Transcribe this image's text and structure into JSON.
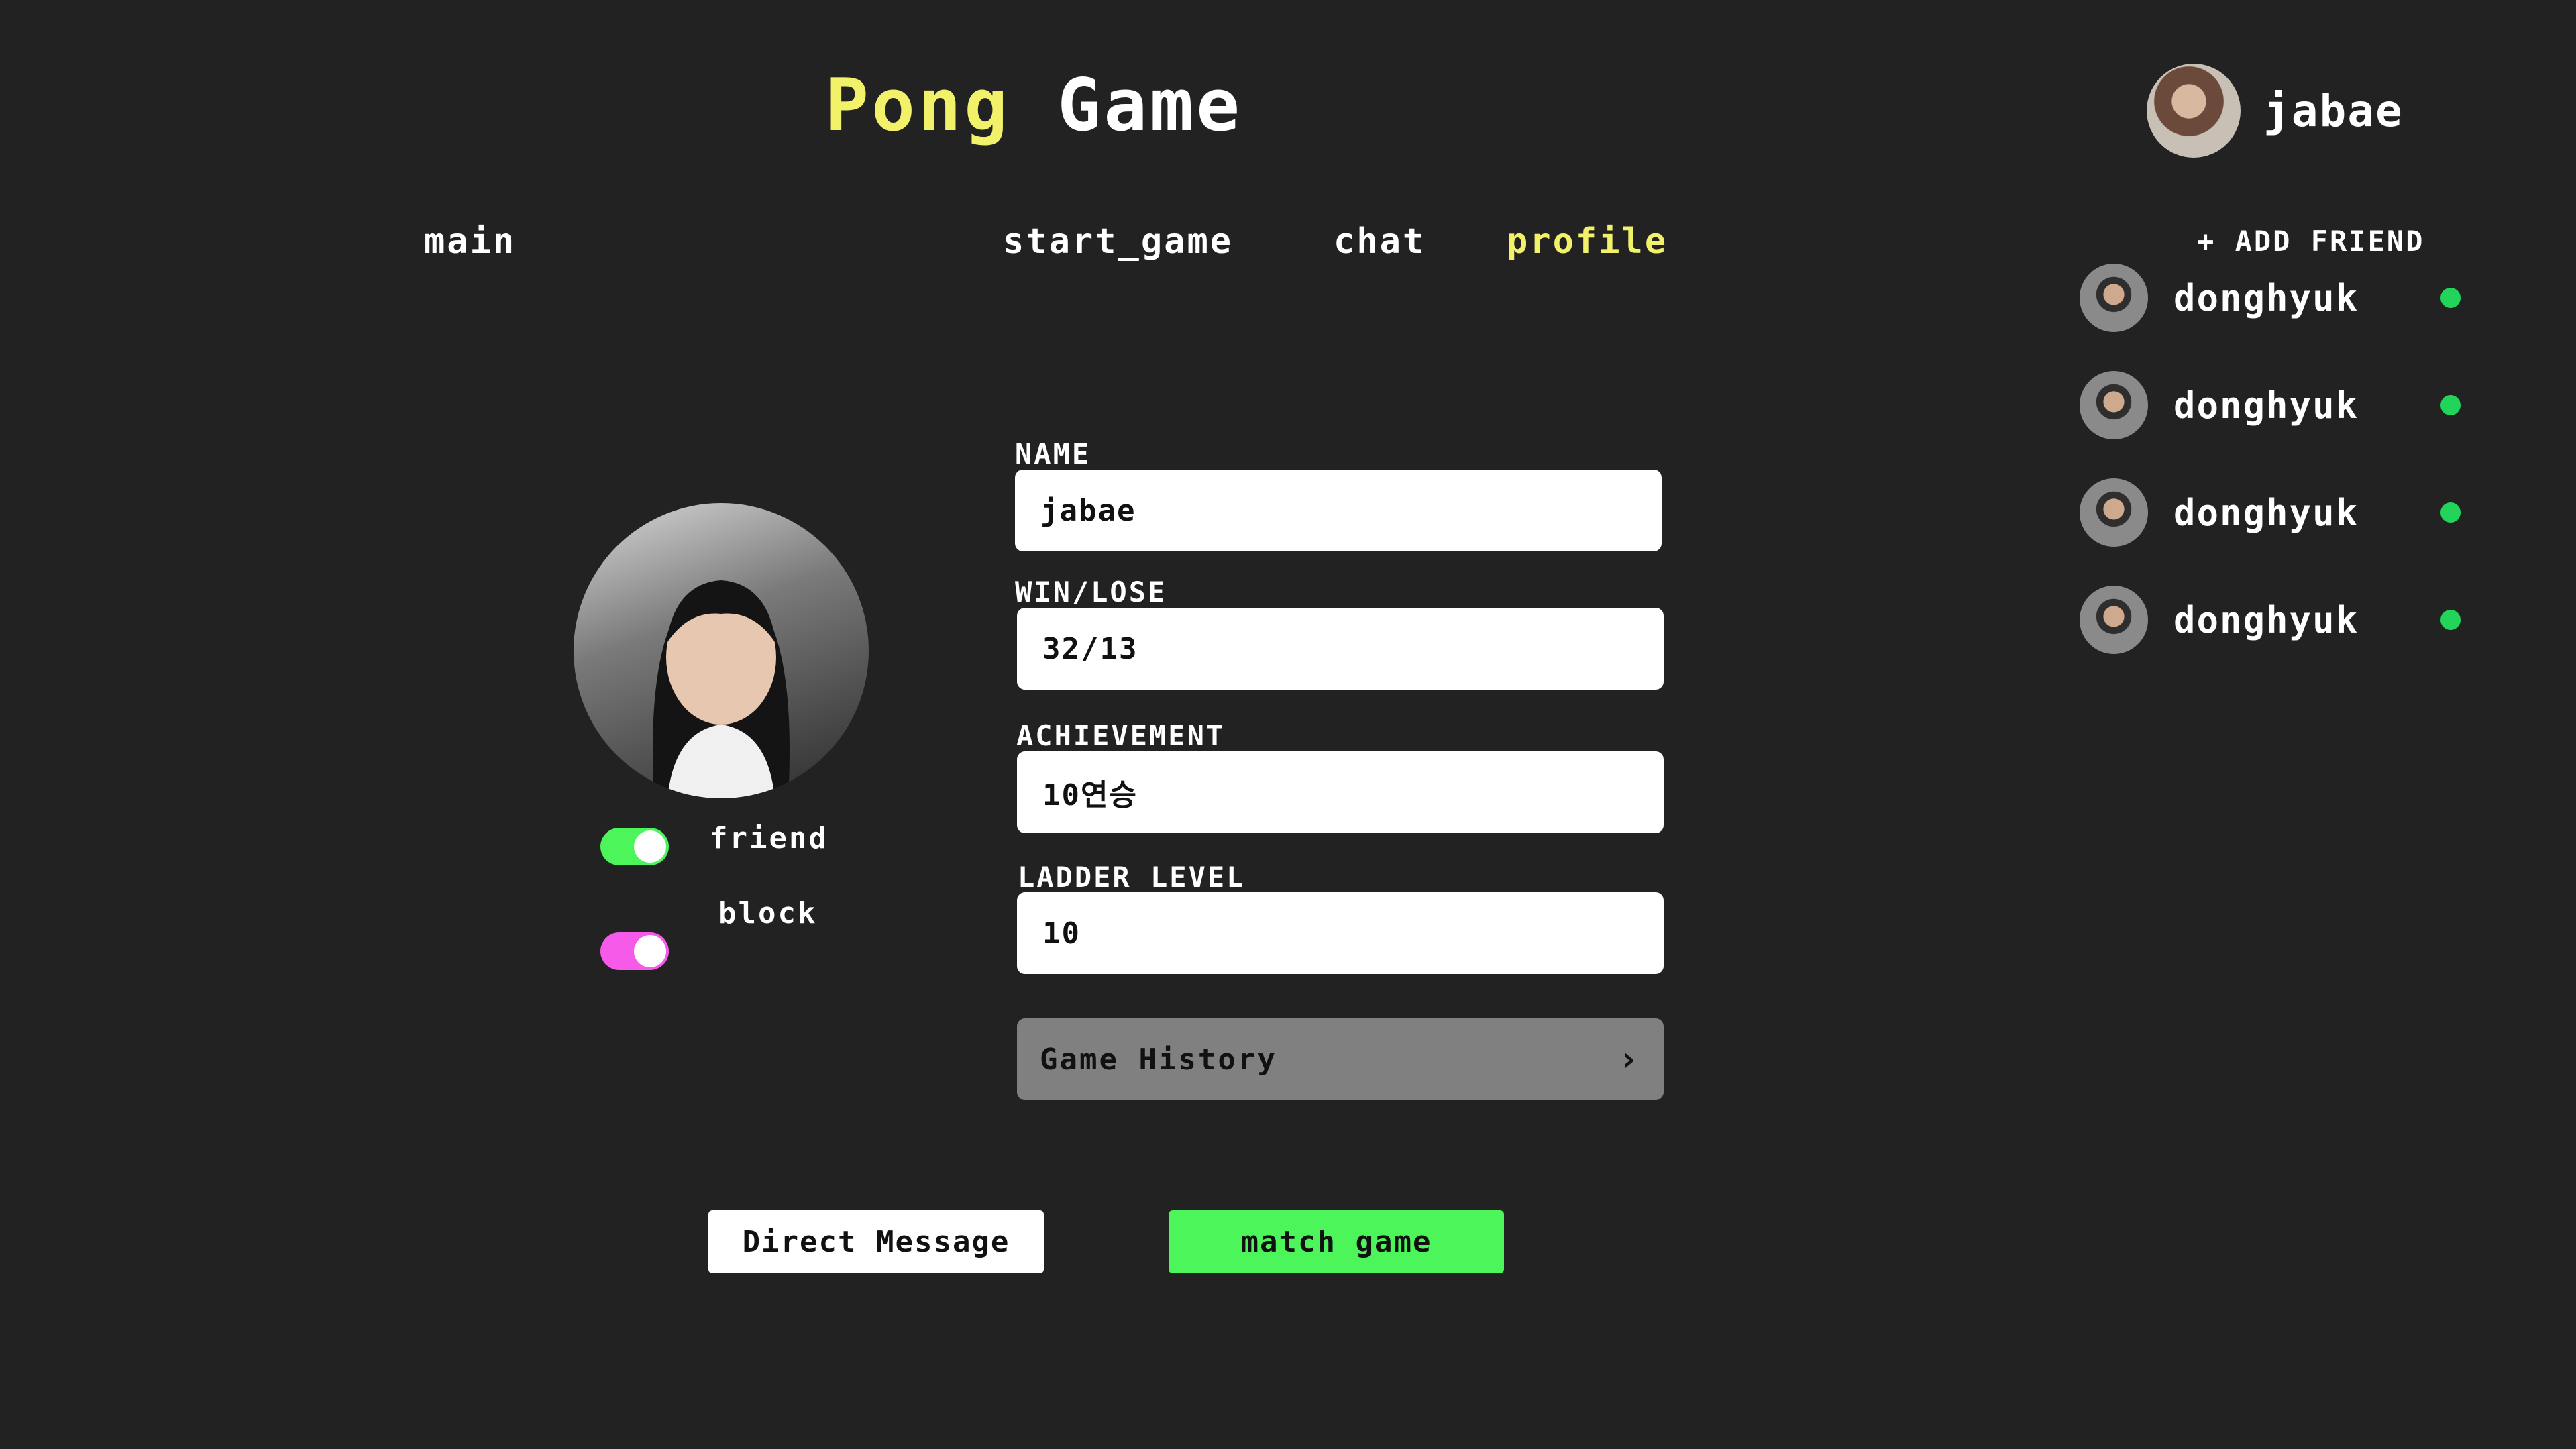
{
  "app": {
    "title_word1": "Pong",
    "title_word2": "Game"
  },
  "header": {
    "username": "jabae"
  },
  "nav": {
    "main": "main",
    "start_game": "start_game",
    "chat": "chat",
    "profile": "profile"
  },
  "sidebar": {
    "add_friend_label": "+ ADD FRIEND",
    "friends": [
      {
        "name": "donghyuk",
        "status": "online"
      },
      {
        "name": "donghyuk",
        "status": "online"
      },
      {
        "name": "donghyuk",
        "status": "online"
      },
      {
        "name": "donghyuk",
        "status": "online"
      }
    ]
  },
  "profile": {
    "toggles": {
      "friend_label": "friend",
      "friend_on": true,
      "block_label": "block",
      "block_on": true
    },
    "fields": {
      "name_label": "NAME",
      "name_value": "jabae",
      "winlose_label": "WIN/LOSE",
      "winlose_value": "32/13",
      "achievement_label": "ACHIEVEMENT",
      "achievement_value": "10연승",
      "ladder_label": "LADDER LEVEL",
      "ladder_value": "10"
    },
    "history_label": "Game History",
    "dm_label": "Direct Message",
    "match_label": "match game"
  },
  "colors": {
    "accent_yellow": "#f2f26a",
    "online_green": "#22d45a",
    "toggle_green": "#4cf55a",
    "toggle_pink": "#f55ae8",
    "match_green": "#4cf55a"
  }
}
